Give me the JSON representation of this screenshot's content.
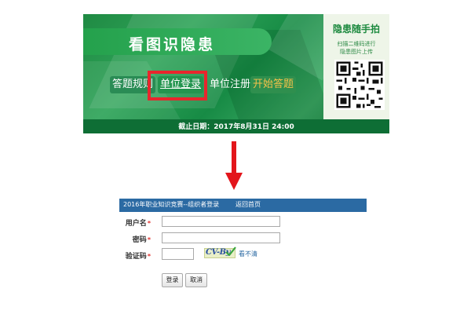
{
  "banner": {
    "title": "看图识隐患",
    "nav": {
      "rules": "答题规则",
      "login": "单位登录",
      "register": "单位注册",
      "start": "开始答题"
    },
    "deadline": "截止日期：2017年8月31日  24:00",
    "qr": {
      "title": "隐患随手拍",
      "line1": "扫描二维码进行",
      "line2": "隐患图片上传"
    }
  },
  "form": {
    "header_title": "2016年职业知识竞赛--组织者登录",
    "header_link": "返回首页",
    "labels": {
      "username": "用户名",
      "password": "密码",
      "captcha": "验证码",
      "required_mark": "*"
    },
    "captcha_text": "CV-By",
    "refresh": "看不清",
    "buttons": {
      "login": "登录",
      "cancel": "取消"
    }
  },
  "colors": {
    "highlight": "#e8262d",
    "header_bar": "#2b6aa3",
    "start_text": "#f3c14a"
  }
}
